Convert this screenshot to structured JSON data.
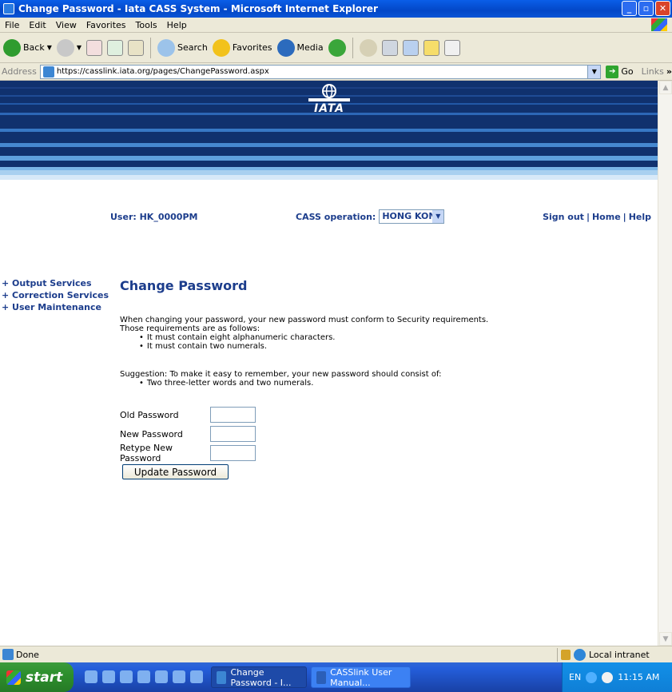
{
  "window": {
    "title": "Change Password - Iata CASS System - Microsoft Internet Explorer",
    "buttons": [
      "minimize-icon",
      "maximize-icon",
      "close-icon"
    ]
  },
  "menu": [
    "File",
    "Edit",
    "View",
    "Favorites",
    "Tools",
    "Help"
  ],
  "toolbar": {
    "back_label": "Back",
    "search_label": "Search",
    "favorites_label": "Favorites",
    "media_label": "Media"
  },
  "address": {
    "label": "Address",
    "url": "https://casslink.iata.org/pages/ChangePassword.aspx",
    "go_label": "Go",
    "links_label": "Links"
  },
  "banner": {
    "logo_text": "IATA"
  },
  "userbar": {
    "user_text": "User:  HK_0000PM",
    "cass_label": "CASS operation:",
    "cass_value": "HONG KONG",
    "links": {
      "signout": "Sign out",
      "home": "Home",
      "help": "Help",
      "sep": "|"
    }
  },
  "sidenav": [
    "+ Output Services",
    "+ Correction Services",
    "+ User Maintenance"
  ],
  "content": {
    "heading": "Change Password",
    "intro1": "When changing your password, your new password must conform to Security requirements.",
    "intro2": "Those requirements are as follows:",
    "requirements": [
      "It must contain eight alphanumeric characters.",
      "It must contain two numerals."
    ],
    "suggestion": "Suggestion: To make it easy to remember, your new password should consist of:",
    "suggestions": [
      "Two three-letter words and two numerals."
    ]
  },
  "form": {
    "old_label": "Old Password",
    "new_label": "New Password",
    "retype_label": "Retype New Password",
    "old_value": "",
    "new_value": "",
    "retype_value": "",
    "submit_label": "Update Password"
  },
  "status": {
    "text": "Done",
    "zone": "Local intranet"
  },
  "taskbar": {
    "start": "start",
    "tasks": [
      "Change Password - I...",
      "CASSlink User Manual..."
    ],
    "lang": "EN",
    "time": "11:15 AM"
  }
}
